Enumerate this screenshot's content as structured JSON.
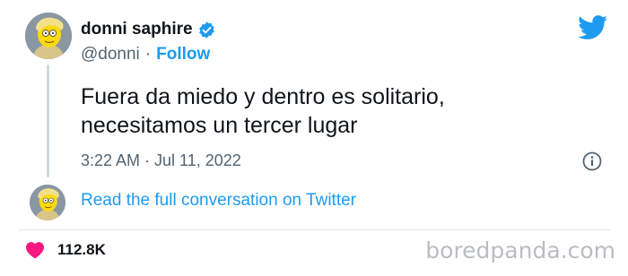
{
  "author": {
    "display_name": "donni saphire",
    "handle": "@donni",
    "separator": "·",
    "follow_label": "Follow"
  },
  "tweet": {
    "lines": [
      "Fuera da miedo y dentro es solitario,",
      "necesitamos un tercer lugar"
    ],
    "timestamp": "3:22 AM · Jul 11, 2022"
  },
  "conversation_link": "Read the full conversation on Twitter",
  "engagement": {
    "likes": "112.8K"
  },
  "watermark": "boredpanda.com",
  "colors": {
    "link": "#1d9bf0",
    "heart": "#f91880",
    "text": "#0f1419",
    "muted": "#536471"
  },
  "icons": [
    "verified-badge-icon",
    "twitter-bird-icon",
    "info-icon",
    "heart-icon"
  ]
}
